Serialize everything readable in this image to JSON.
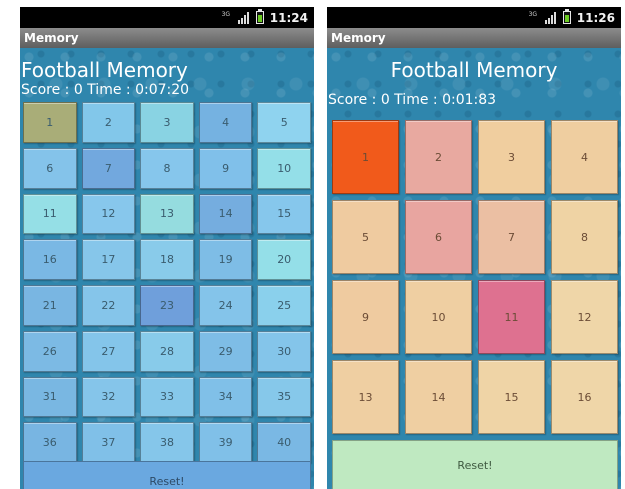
{
  "left_screen": {
    "status": {
      "network": "3G",
      "time": "11:24"
    },
    "app_title": "Memory",
    "game_title": "Football Memory",
    "score_line": "Score : 0  Time : 0:07:20",
    "reset_label": "Reset!",
    "tiles": [
      {
        "label": "1",
        "color": "#a9ad78"
      },
      {
        "label": "2",
        "color": "#82c7ea"
      },
      {
        "label": "3",
        "color": "#89d3e3"
      },
      {
        "label": "4",
        "color": "#75b2e1"
      },
      {
        "label": "5",
        "color": "#8fd3ef"
      },
      {
        "label": "6",
        "color": "#84c3ea"
      },
      {
        "label": "7",
        "color": "#72a8de"
      },
      {
        "label": "8",
        "color": "#86c6ec"
      },
      {
        "label": "9",
        "color": "#80c0ea"
      },
      {
        "label": "10",
        "color": "#94dfe8"
      },
      {
        "label": "11",
        "color": "#95dfe6"
      },
      {
        "label": "12",
        "color": "#87c7ec"
      },
      {
        "label": "13",
        "color": "#95dcdf"
      },
      {
        "label": "14",
        "color": "#75addf"
      },
      {
        "label": "15",
        "color": "#86c7ec"
      },
      {
        "label": "16",
        "color": "#7ab8e4"
      },
      {
        "label": "17",
        "color": "#86c6ea"
      },
      {
        "label": "18",
        "color": "#89cbea"
      },
      {
        "label": "19",
        "color": "#7ebde6"
      },
      {
        "label": "20",
        "color": "#94dfe8"
      },
      {
        "label": "21",
        "color": "#79b6e2"
      },
      {
        "label": "22",
        "color": "#85c5ea"
      },
      {
        "label": "23",
        "color": "#6f9fdb"
      },
      {
        "label": "24",
        "color": "#84c4ea"
      },
      {
        "label": "25",
        "color": "#8ad0ec"
      },
      {
        "label": "26",
        "color": "#7cbae4"
      },
      {
        "label": "27",
        "color": "#84c5ea"
      },
      {
        "label": "28",
        "color": "#88cbea"
      },
      {
        "label": "29",
        "color": "#7ebde6"
      },
      {
        "label": "30",
        "color": "#84c5ea"
      },
      {
        "label": "31",
        "color": "#79b7e2"
      },
      {
        "label": "32",
        "color": "#85c5ea"
      },
      {
        "label": "33",
        "color": "#86c8ea"
      },
      {
        "label": "34",
        "color": "#80c0e8"
      },
      {
        "label": "35",
        "color": "#86c8ea"
      },
      {
        "label": "36",
        "color": "#78b5e2"
      },
      {
        "label": "37",
        "color": "#80c0e8"
      },
      {
        "label": "38",
        "color": "#85c6ea"
      },
      {
        "label": "39",
        "color": "#80c0e8"
      },
      {
        "label": "40",
        "color": "#7ab8e4"
      }
    ]
  },
  "right_screen": {
    "status": {
      "network": "3G",
      "time": "11:26"
    },
    "app_title": "Memory",
    "game_title": "Football Memory",
    "score_line": "Score : 0  Time : 0:01:83",
    "reset_label": "Reset!",
    "tiles": [
      {
        "label": "1",
        "color": "#f15a1b"
      },
      {
        "label": "2",
        "color": "#e8a9a0"
      },
      {
        "label": "3",
        "color": "#f0ce9f"
      },
      {
        "label": "4",
        "color": "#efcea0"
      },
      {
        "label": "5",
        "color": "#efcba0"
      },
      {
        "label": "6",
        "color": "#e8a5a0"
      },
      {
        "label": "7",
        "color": "#ebbfa3"
      },
      {
        "label": "8",
        "color": "#efd3a4"
      },
      {
        "label": "9",
        "color": "#efcba0"
      },
      {
        "label": "10",
        "color": "#efcfa2"
      },
      {
        "label": "11",
        "color": "#de7190"
      },
      {
        "label": "12",
        "color": "#efd6a8"
      },
      {
        "label": "13",
        "color": "#efcfa2"
      },
      {
        "label": "14",
        "color": "#efcfa2"
      },
      {
        "label": "15",
        "color": "#efd4a6"
      },
      {
        "label": "16",
        "color": "#efd6a8"
      }
    ]
  }
}
